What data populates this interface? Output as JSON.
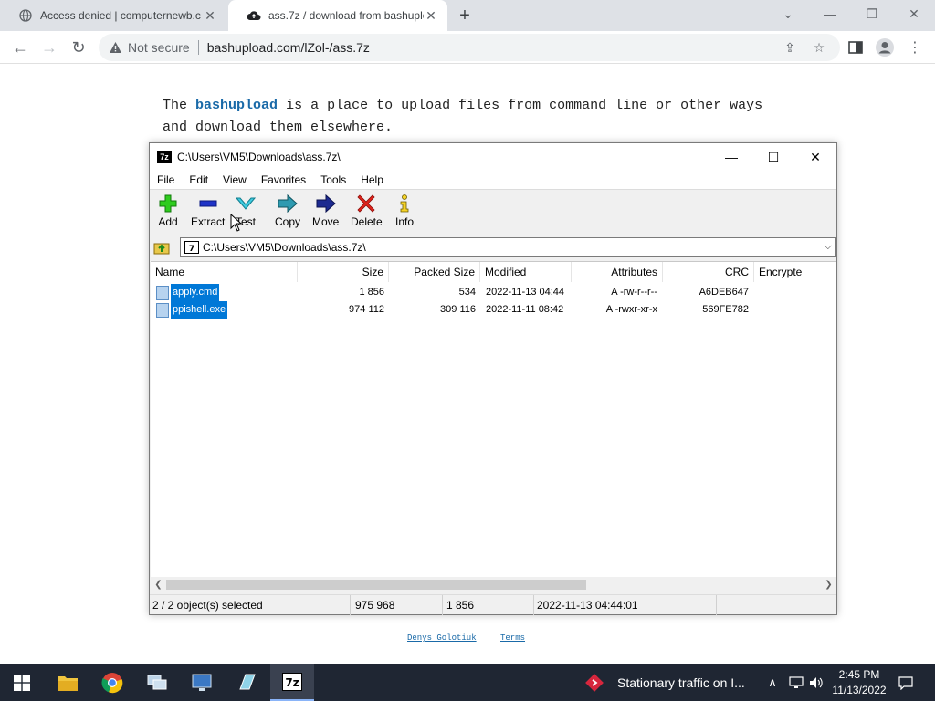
{
  "browser": {
    "tabs": [
      {
        "title": "Access denied | computernewb.c",
        "active": false
      },
      {
        "title": "ass.7z / download from bashuplo",
        "active": true
      }
    ],
    "security_label": "Not secure",
    "url": "bashupload.com/lZol-/ass.7z"
  },
  "page": {
    "intro_prefix": "The",
    "intro_link": "bashupload",
    "intro_rest": "is a place to upload files from command line or other ways and download them elsewhere.",
    "footer_links": [
      "Denys Golotiuk",
      "Terms"
    ]
  },
  "zip": {
    "title": "C:\\Users\\VM5\\Downloads\\ass.7z\\",
    "app_icon_text": "7z",
    "menu": [
      "File",
      "Edit",
      "View",
      "Favorites",
      "Tools",
      "Help"
    ],
    "toolbar": [
      "Add",
      "Extract",
      "Test",
      "Copy",
      "Move",
      "Delete",
      "Info"
    ],
    "address": "C:\\Users\\VM5\\Downloads\\ass.7z\\",
    "columns": [
      "Name",
      "Size",
      "Packed Size",
      "Modified",
      "Attributes",
      "CRC",
      "Encrypte"
    ],
    "rows": [
      {
        "name": "apply.cmd",
        "size": "1 856",
        "packed": "534",
        "modified": "2022-11-13 04:44",
        "attributes": "A -rw-r--r--",
        "crc": "A6DEB647"
      },
      {
        "name": "ppishell.exe",
        "size": "974 112",
        "packed": "309 116",
        "modified": "2022-11-11 08:42",
        "attributes": "A -rwxr-xr-x",
        "crc": "569FE782"
      }
    ],
    "status": {
      "selected": "2 / 2 object(s) selected",
      "total_size": "975 968",
      "item_size": "1 856",
      "modified": "2022-11-13 04:44:01"
    }
  },
  "taskbar": {
    "notification": "Stationary traffic on I...",
    "time": "2:45 PM",
    "date": "11/13/2022"
  },
  "colors": {
    "selection": "#0078d7",
    "link": "#1a6aa8",
    "taskbar": "#1f2633"
  }
}
